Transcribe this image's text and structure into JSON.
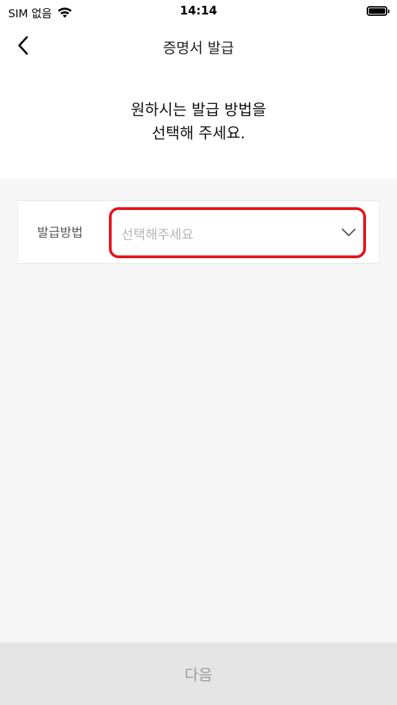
{
  "status_bar": {
    "carrier": "SIM 없음",
    "time": "14:14"
  },
  "header": {
    "title": "증명서 발급",
    "instruction_line1": "원하시는 발급 방법을",
    "instruction_line2": "선택해 주세요."
  },
  "form": {
    "method_label": "발급방법",
    "method_placeholder": "선택해주세요"
  },
  "footer": {
    "next_label": "다음"
  },
  "colors": {
    "highlight_border": "#e8121b",
    "button_bg": "#e5e5e5",
    "button_text": "#9b9b9b"
  }
}
